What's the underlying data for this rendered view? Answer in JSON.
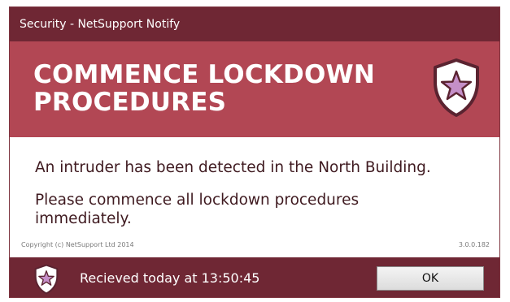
{
  "window": {
    "title": "Security - NetSupport Notify"
  },
  "banner": {
    "headline_line1": "COMMENCE LOCKDOWN",
    "headline_line2": "PROCEDURES",
    "icon": "shield-star-icon"
  },
  "message": {
    "line1": "An intruder has been detected in the North Building.",
    "line2": "Please commence all lockdown procedures immediately."
  },
  "meta": {
    "copyright": "Copyright (c) NetSupport Ltd 2014",
    "version": "3.0.0.182"
  },
  "footer": {
    "icon": "shield-star-icon",
    "received": "Recieved today at 13:50:45",
    "ok_label": "OK"
  },
  "colors": {
    "titlebar": "#6f2734",
    "banner": "#b24754",
    "footer": "#6f2734",
    "shield_star": "#c58fc8"
  }
}
